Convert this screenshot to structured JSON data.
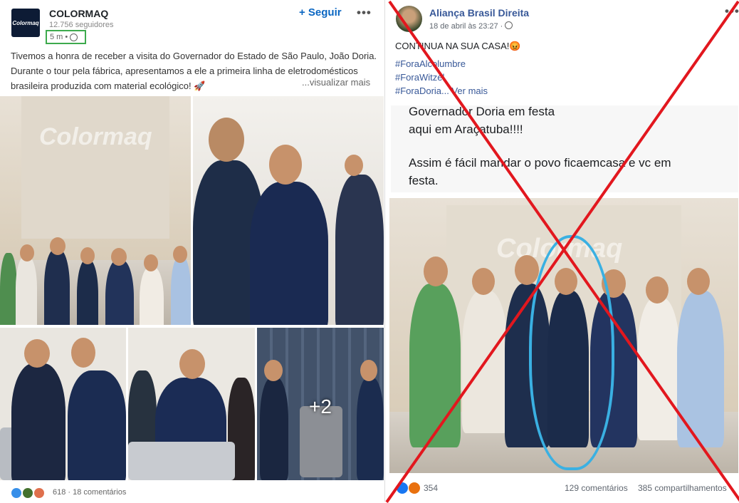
{
  "left_post": {
    "company": "COLORMAQ",
    "followers": "12.756 seguidores",
    "time": "5 m •",
    "follow_label": "+ Seguir",
    "more_label": "•••",
    "text": "Tivemos a honra de receber a visita do Governador do Estado de São Paulo, João Doria. Durante o tour pela fábrica, apresentamos a ele a primeira linha de eletrodomésticos brasileira produzida com material ecológico! 🚀",
    "see_more": "...visualizar mais",
    "logo_text": "Colormaq",
    "extra_photos": "+2",
    "reactions_count": "618",
    "comments": "18 comentários",
    "highlight_color": "#3daa4d"
  },
  "right_post": {
    "page_name": "Aliança Brasil Direita",
    "date": "18 de abril às 23:27 ·",
    "more_label": "•••",
    "headline": "CONTINUA NA SUA CASA!😡",
    "hashtags": [
      "#ForaAlcolumbre",
      "#ForaWitzel",
      "#ForaDoria... Ver mais"
    ],
    "inner_line1": "Governador Doria em festa",
    "inner_line2": " aqui em Araçatuba!!!!",
    "inner_line3": "Assim é fácil mandar o povo ficaemcasa e vc em",
    "inner_line4": "festa.",
    "reactions_count": "354",
    "comments": "129 comentários",
    "shares": "385 compartilhamentos",
    "cross_color": "#e2171e",
    "circle_color": "#3ab0e2"
  }
}
